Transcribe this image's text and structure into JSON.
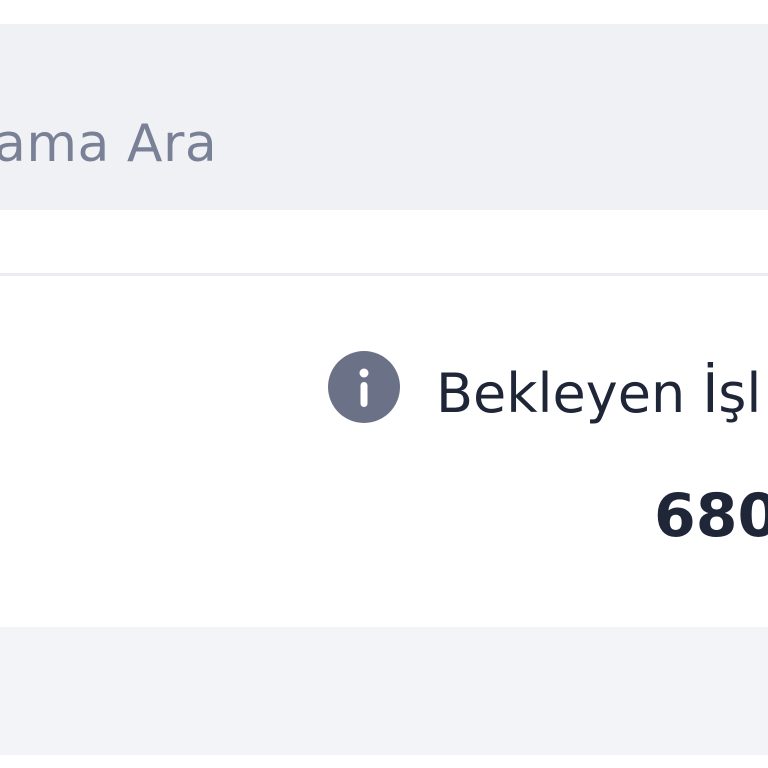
{
  "search": {
    "placeholder": "ama Ara"
  },
  "summary": {
    "pending_label": "Bekleyen İşl",
    "pending_value": "680"
  },
  "icons": {
    "info": "info-icon"
  },
  "colors": {
    "search_background": "#f0f1f5",
    "search_text": "#7a8196",
    "icon_background": "#6b7288",
    "primary_text": "#1f2638",
    "bottom_background": "#f3f4f8"
  }
}
